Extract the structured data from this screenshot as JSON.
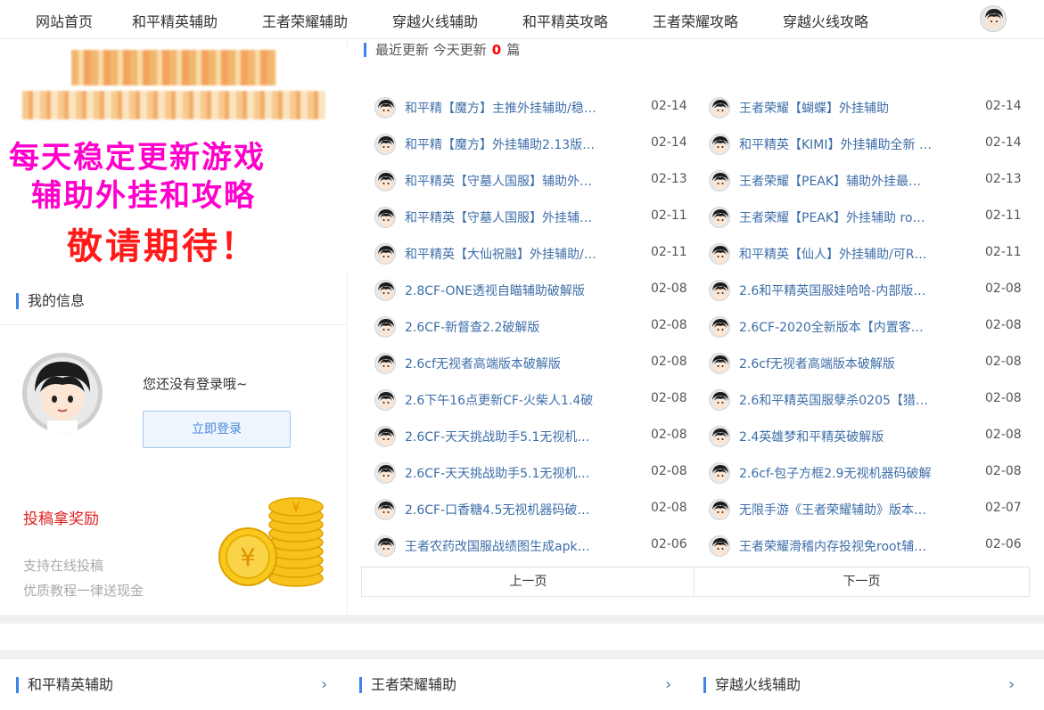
{
  "nav": {
    "items": [
      {
        "label": "网站首页"
      },
      {
        "label": "和平精英辅助"
      },
      {
        "label": "王者荣耀辅助"
      },
      {
        "label": "穿越火线辅助"
      },
      {
        "label": "和平精英攻略"
      },
      {
        "label": "王者荣耀攻略"
      },
      {
        "label": "穿越火线攻略"
      }
    ]
  },
  "banner": {
    "line1": "每天稳定更新游戏",
    "line2": "辅助外挂和攻略",
    "line3": "敬请期待！"
  },
  "sidebar": {
    "my_info_title": "我的信息",
    "not_logged": "您还没有登录哦~",
    "login_button": "立即登录",
    "reward_title": "投稿拿奖励",
    "reward_line1": "支持在线投稿",
    "reward_line2": "优质教程一律送现金"
  },
  "recent": {
    "label": "最近更新 今天更新",
    "count": "0",
    "unit": "篇",
    "left": [
      {
        "title": "和平精【魔方】主推外挂辅助/稳…",
        "date": "02-14"
      },
      {
        "title": "和平精【魔方】外挂辅助2.13版…",
        "date": "02-14"
      },
      {
        "title": "和平精英【守墓人国服】辅助外…",
        "date": "02-13"
      },
      {
        "title": "和平精英【守墓人国服】外挂辅…",
        "date": "02-11"
      },
      {
        "title": "和平精英【大仙祝融】外挂辅助/…",
        "date": "02-11"
      },
      {
        "title": "2.8CF-ONE透视自瞄辅助破解版",
        "date": "02-08"
      },
      {
        "title": "2.6CF-新督查2.2破解版",
        "date": "02-08"
      },
      {
        "title": "2.6cf无视者高端版本破解版",
        "date": "02-08"
      },
      {
        "title": "2.6下午16点更新CF-火柴人1.4破",
        "date": "02-08"
      },
      {
        "title": "2.6CF-天天挑战助手5.1无视机…",
        "date": "02-08"
      },
      {
        "title": "2.6CF-天天挑战助手5.1无视机…",
        "date": "02-08"
      },
      {
        "title": "2.6CF-口香糖4.5无视机器码破…",
        "date": "02-08"
      },
      {
        "title": "王者农药改国服战绩图生成apk…",
        "date": "02-06"
      }
    ],
    "right": [
      {
        "title": "王者荣耀【蝴蝶】外挂辅助",
        "date": "02-14"
      },
      {
        "title": "和平精英【KIMI】外挂辅助全新 …",
        "date": "02-14"
      },
      {
        "title": "王者荣耀【PEAK】辅助外挂最…",
        "date": "02-13"
      },
      {
        "title": "王者荣耀【PEAK】外挂辅助 ro…",
        "date": "02-11"
      },
      {
        "title": "和平精英【仙人】外挂辅助/可R…",
        "date": "02-11"
      },
      {
        "title": "2.6和平精英国服娃哈哈-内部版…",
        "date": "02-08"
      },
      {
        "title": "2.6CF-2020全新版本【内置客户效",
        "date": "02-08"
      },
      {
        "title": "2.6cf无视者高端版本破解版",
        "date": "02-08"
      },
      {
        "title": "2.6和平精英国服孽杀0205【猎…",
        "date": "02-08"
      },
      {
        "title": "2.4英雄梦和平精英破解版",
        "date": "02-08"
      },
      {
        "title": "2.6cf-包子方框2.9无视机器码破解",
        "date": "02-08"
      },
      {
        "title": "无限手游《王者荣耀辅助》版本…",
        "date": "02-07"
      },
      {
        "title": "王者荣耀滑稽内存投视免root辅…",
        "date": "02-06"
      }
    ],
    "prev": "上一页",
    "next": "下一页"
  },
  "bottom": {
    "sections": [
      {
        "label": "和平精英辅助"
      },
      {
        "label": "王者荣耀辅助"
      },
      {
        "label": "穿越火线辅助"
      }
    ]
  },
  "colors": {
    "accent": "#3b86e6",
    "link": "#3d6ea8",
    "red": "#e02020",
    "banner_pink": "#ff00cc"
  }
}
